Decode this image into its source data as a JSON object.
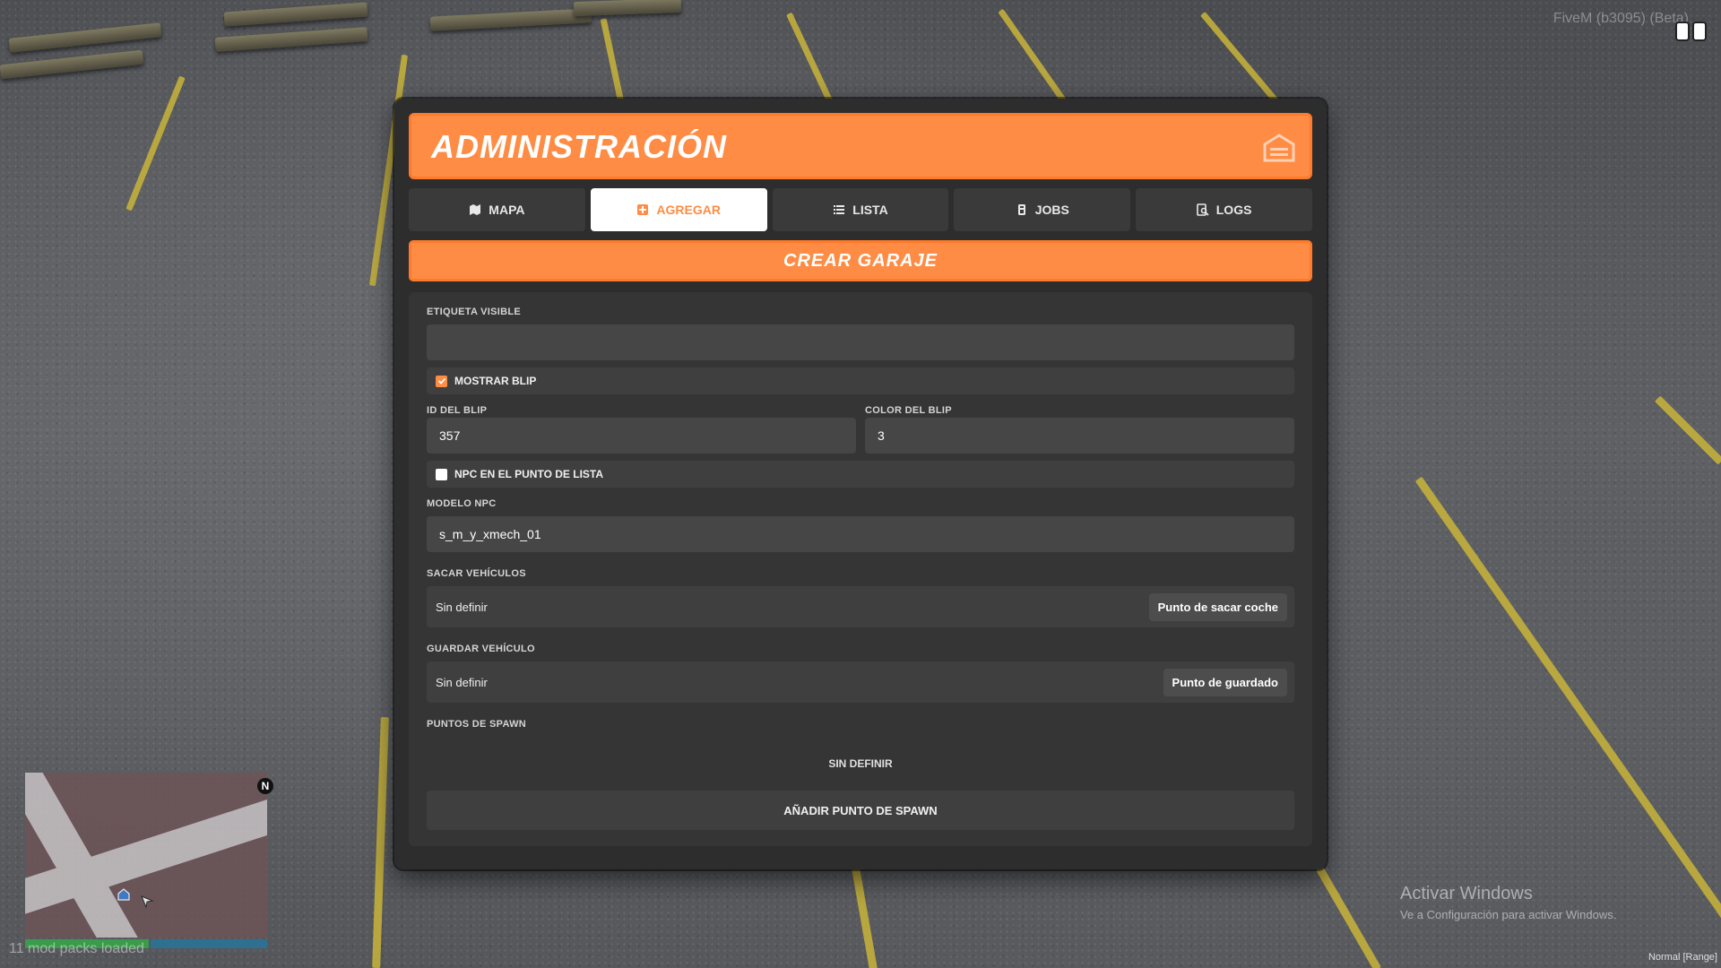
{
  "game_overlay": {
    "fivem_label": "FiveM (b3095) (Beta)",
    "mods_loaded": "11 mod packs loaded",
    "north_label": "N",
    "activate_windows_title": "Activar Windows",
    "activate_windows_sub": "Ve a Configuración para activar Windows.",
    "mode_label": "Normal [Range]"
  },
  "header": {
    "title": "ADMINISTRACIÓN",
    "icon": "garage-icon"
  },
  "tabs": [
    {
      "label": "MAPA",
      "icon": "map-icon",
      "active": false
    },
    {
      "label": "AGREGAR",
      "icon": "plus-square-icon",
      "active": true
    },
    {
      "label": "LISTA",
      "icon": "list-icon",
      "active": false
    },
    {
      "label": "JOBS",
      "icon": "badge-icon",
      "active": false
    },
    {
      "label": "LOGS",
      "icon": "search-doc-icon",
      "active": false
    }
  ],
  "section": {
    "title": "CREAR GARAJE"
  },
  "form": {
    "visible_label": {
      "label": "ETIQUETA VISIBLE",
      "value": ""
    },
    "show_blip": {
      "label": "MOSTRAR BLIP",
      "checked": true
    },
    "blip_id": {
      "label": "ID DEL BLIP",
      "value": "357"
    },
    "blip_color": {
      "label": "COLOR DEL BLIP",
      "value": "3"
    },
    "npc_point": {
      "label": "NPC EN EL PUNTO DE LISTA",
      "checked": false
    },
    "npc_model": {
      "label": "MODELO NPC",
      "value": "s_m_y_xmech_01"
    },
    "take_vehicles": {
      "label": "SACAR VEHÍCULOS",
      "value": "Sin definir",
      "button": "Punto de sacar coche"
    },
    "store_vehicle": {
      "label": "GUARDAR VEHÍCULO",
      "value": "Sin definir",
      "button": "Punto de guardado"
    },
    "spawn_points": {
      "label": "PUNTOS DE SPAWN",
      "empty": "SIN DEFINIR",
      "add_button": "AÑADIR PUNTO DE SPAWN"
    }
  },
  "colors": {
    "accent": "#fe8c44",
    "panel_bg": "#2d2d2e"
  }
}
